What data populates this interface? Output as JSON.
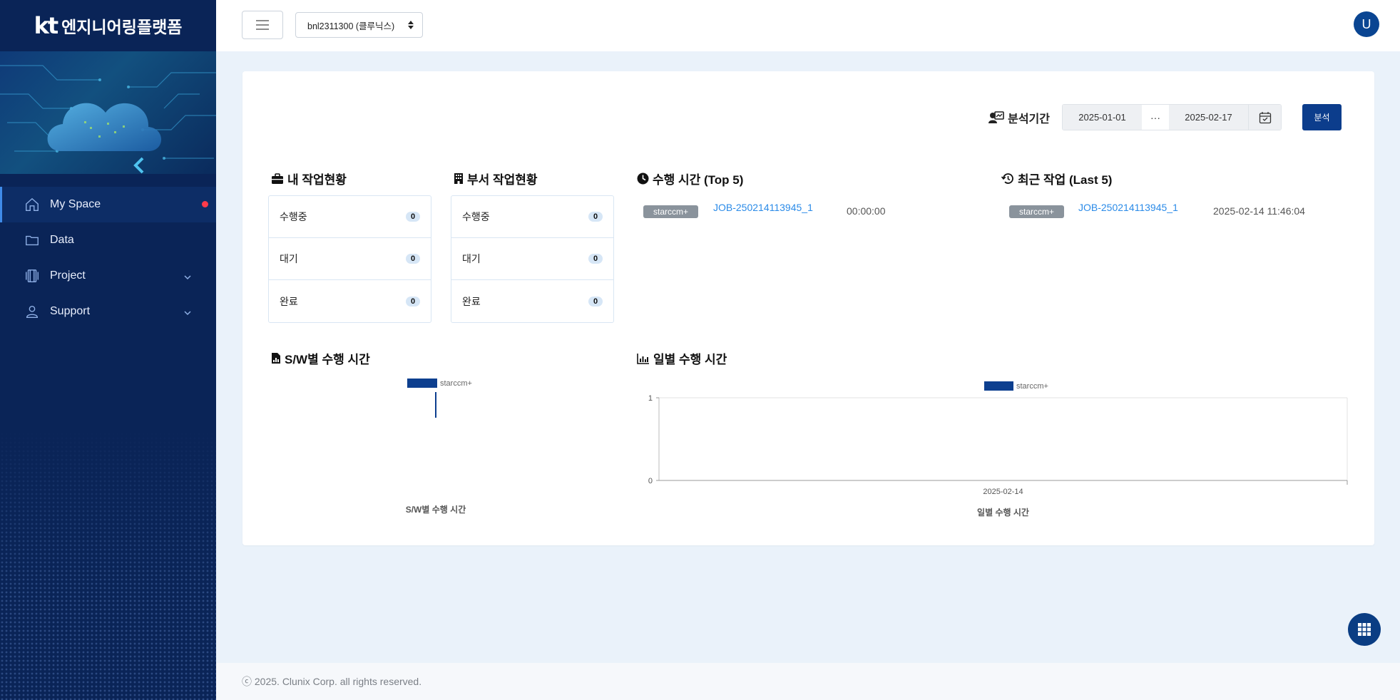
{
  "brand": {
    "logo": "kt",
    "name": "엔지니어링플랫폼"
  },
  "sidebar": {
    "items": [
      {
        "label": "My Space",
        "icon": "home-icon",
        "active": true,
        "has_notification": true
      },
      {
        "label": "Data",
        "icon": "folder-icon"
      },
      {
        "label": "Project",
        "icon": "project-icon",
        "expandable": true
      },
      {
        "label": "Support",
        "icon": "user-icon",
        "expandable": true
      }
    ]
  },
  "topbar": {
    "org_selected": "bnl2311300 (클루닉스)",
    "avatar_initial": "U"
  },
  "period": {
    "label": "분석기간",
    "start_date": "2025-01-01",
    "separator": "···",
    "end_date": "2025-02-17",
    "analyze_label": "분석"
  },
  "my_status": {
    "title": "내 작업현황",
    "rows": [
      {
        "label": "수행중",
        "count": "0"
      },
      {
        "label": "대기",
        "count": "0"
      },
      {
        "label": "완료",
        "count": "0"
      }
    ]
  },
  "dept_status": {
    "title": "부서 작업현황",
    "rows": [
      {
        "label": "수행중",
        "count": "0"
      },
      {
        "label": "대기",
        "count": "0"
      },
      {
        "label": "완료",
        "count": "0"
      }
    ]
  },
  "top5": {
    "title": "수행 시간 (Top 5)",
    "jobs": [
      {
        "sw": "starccm+",
        "job": "JOB-250214113945_1",
        "value": "00:00:00"
      }
    ]
  },
  "last5": {
    "title": "최근 작업 (Last 5)",
    "jobs": [
      {
        "sw": "starccm+",
        "job": "JOB-250214113945_1",
        "value": "2025-02-14 11:46:04"
      }
    ]
  },
  "sw_chart_section": {
    "title": "S/W별 수행 시간"
  },
  "daily_chart_section": {
    "title": "일별 수행 시간"
  },
  "colors": {
    "primary": "#0c3d8c",
    "sidebar": "#0a2457",
    "link": "#2b8be8",
    "series": "#0d3f8f"
  },
  "chart_data": [
    {
      "type": "bar",
      "title": "",
      "xlabel": "S/W별 수행 시간",
      "categories": [
        ""
      ],
      "series": [
        {
          "name": "starccm+",
          "values": [
            0
          ]
        }
      ],
      "legend": "top"
    },
    {
      "type": "bar",
      "title": "",
      "xlabel": "일별 수행 시간",
      "categories": [
        "2025-02-14"
      ],
      "series": [
        {
          "name": "starccm+",
          "values": [
            0
          ]
        }
      ],
      "ylim": [
        0,
        1
      ],
      "yticks": [
        "1",
        "0"
      ],
      "legend": "top",
      "grid": false
    }
  ],
  "footer": {
    "text": "ⓒ 2025. Clunix Corp. all rights reserved."
  }
}
